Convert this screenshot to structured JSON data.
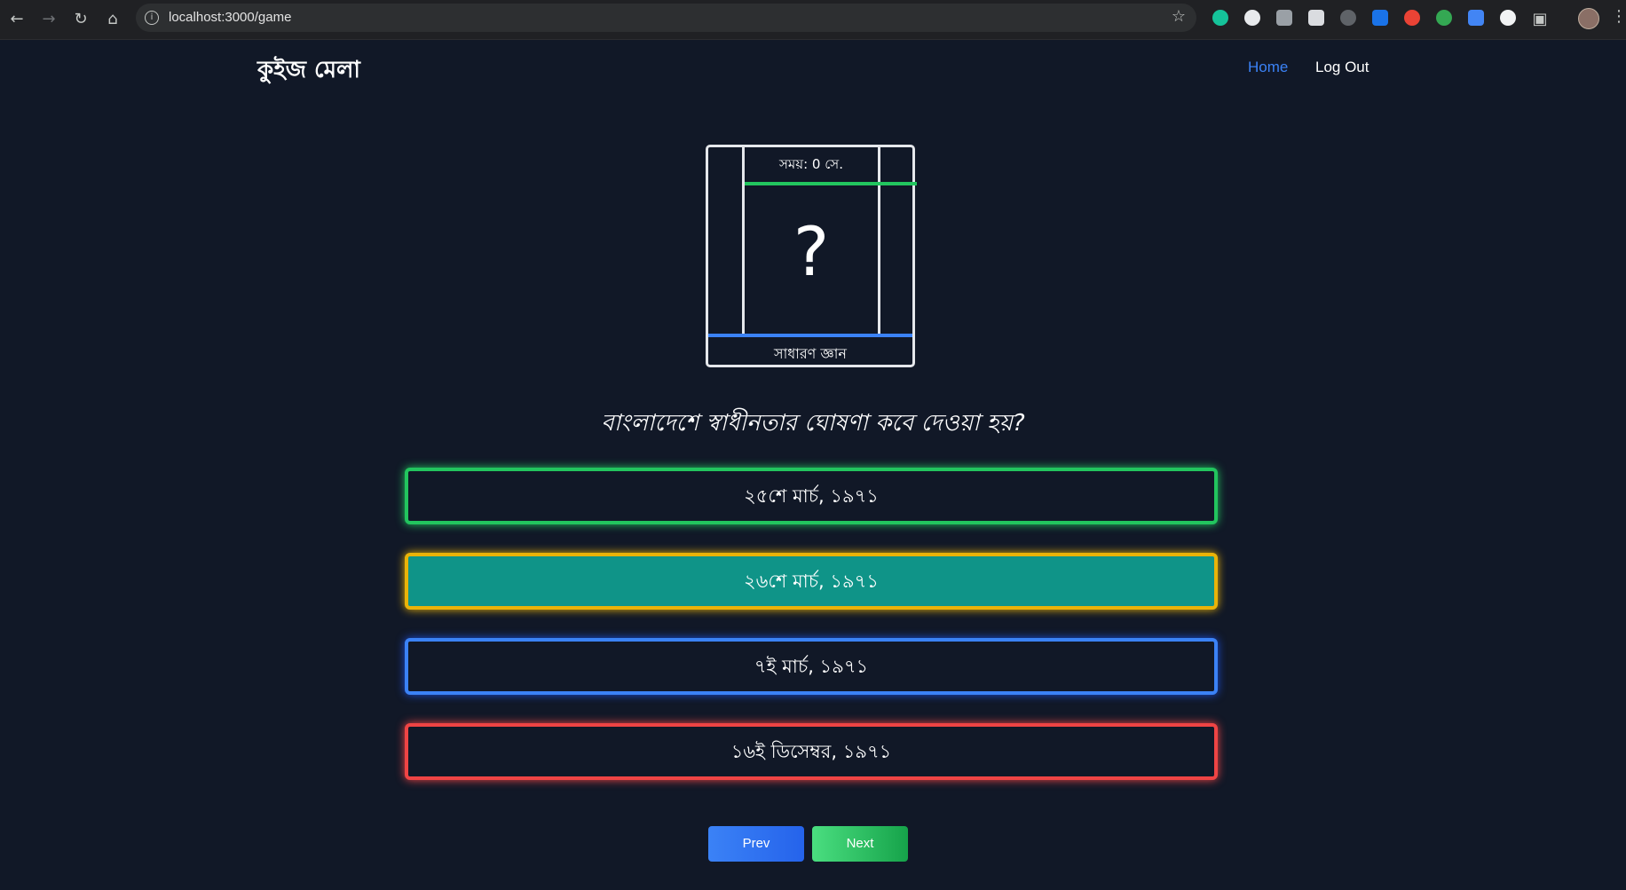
{
  "browser": {
    "url": "localhost:3000/game",
    "icons": [
      "back-icon",
      "forward-icon",
      "reload-icon",
      "home-icon",
      "info-icon",
      "star-icon",
      "extensions-icon",
      "profile-avatar",
      "menu-icon"
    ]
  },
  "header": {
    "brand": "কুইজ মেলা",
    "nav": {
      "home": "Home",
      "logout": "Log Out"
    },
    "colors": {
      "active": "#3b82f6",
      "background": "#111827"
    }
  },
  "card": {
    "timer": "সময়: 0 সে.",
    "question_mark": "?",
    "category": "সাধারণ জ্ঞান"
  },
  "question": "বাংলাদেশে স্বাধীনতার ঘোষণা কবে দেওয়া হয়?",
  "options": [
    {
      "label": "২৫শে মার্চ, ১৯৭১",
      "color": "#22c55e"
    },
    {
      "label": "২৬শে মার্চ, ১৯৭১",
      "color": "#eab308",
      "selected": true
    },
    {
      "label": "৭ই মার্চ, ১৯৭১",
      "color": "#3b82f6"
    },
    {
      "label": "১৬ই ডিসেম্বর, ১৯৭১",
      "color": "#ef4444"
    }
  ],
  "buttons": {
    "prev": "Prev",
    "next": "Next"
  }
}
